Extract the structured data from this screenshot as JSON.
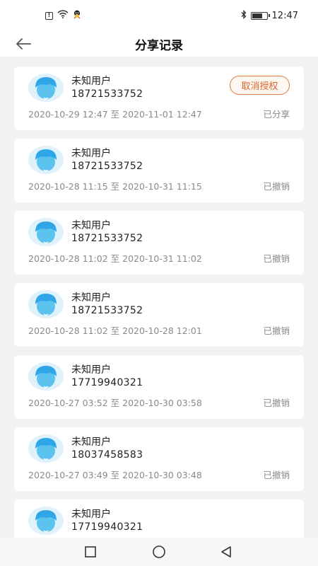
{
  "status_bar": {
    "time": "12:47",
    "icons": [
      "alert-icon",
      "wifi-icon",
      "qq-icon",
      "bluetooth-icon",
      "battery-icon"
    ]
  },
  "header": {
    "title": "分享记录",
    "back_icon": "arrow-left-icon"
  },
  "records": [
    {
      "name": "未知用户",
      "phone": "18721533752",
      "start": "2020-10-29 12:47",
      "sep": "至",
      "end": "2020-11-01 12:47",
      "status": "已分享",
      "action": "取消授权"
    },
    {
      "name": "未知用户",
      "phone": "18721533752",
      "start": "2020-10-28 11:15",
      "sep": "至",
      "end": "2020-10-31 11:15",
      "status": "已撤销"
    },
    {
      "name": "未知用户",
      "phone": "18721533752",
      "start": "2020-10-28 11:02",
      "sep": "至",
      "end": "2020-10-31 11:02",
      "status": "已撤销"
    },
    {
      "name": "未知用户",
      "phone": "18721533752",
      "start": "2020-10-28 11:02",
      "sep": "至",
      "end": "2020-10-28 12:01",
      "status": "已撤销"
    },
    {
      "name": "未知用户",
      "phone": "17719940321",
      "start": "2020-10-27 03:52",
      "sep": "至",
      "end": "2020-10-30 03:58",
      "status": "已撤销"
    },
    {
      "name": "未知用户",
      "phone": "18037458583",
      "start": "2020-10-27 03:49",
      "sep": "至",
      "end": "2020-10-30 03:48",
      "status": "已撤销"
    },
    {
      "name": "未知用户",
      "phone": "17719940321"
    }
  ],
  "colors": {
    "accent": "#e07a3b",
    "avatar_bg": "#dff1fb",
    "avatar_hair": "#2fa6e8",
    "avatar_face": "#5cc3ee"
  },
  "system_nav": {
    "icons": [
      "recent-apps-icon",
      "home-icon",
      "back-triangle-icon"
    ]
  }
}
